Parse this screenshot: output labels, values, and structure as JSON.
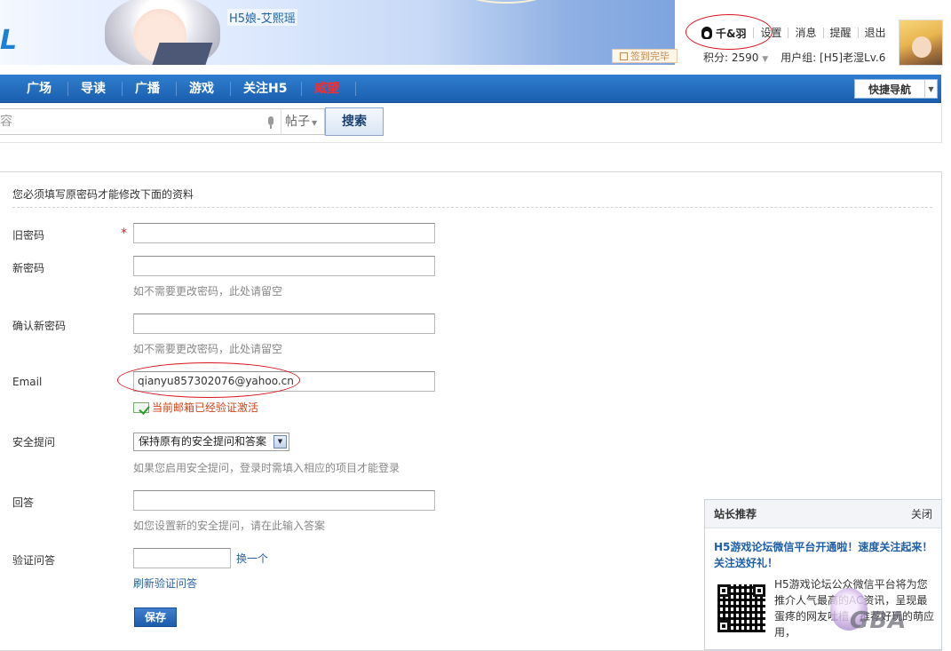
{
  "header": {
    "logo_text": "L",
    "site_subtitle": "H5娘-艾熙瑶",
    "user_name": "千&羽",
    "links": [
      "设置",
      "消息",
      "提醒",
      "退出"
    ],
    "checkin_label": "签到完毕",
    "points_label": "积分: 2590",
    "group_label": "用户组: [H5]老湿Lv.6"
  },
  "nav": {
    "items": [
      "广场",
      "导读",
      "广播",
      "游戏",
      "关注H5",
      "威望"
    ],
    "highlight_color": "#ff2a2a",
    "quick_nav_label": "快捷导航"
  },
  "search": {
    "placeholder_fragment": "容",
    "type_label": "帖子",
    "button_label": "搜索"
  },
  "form": {
    "notice": "您必须填写原密码才能修改下面的资料",
    "old_password_label": "旧密码",
    "required_mark": "*",
    "new_password_label": "新密码",
    "new_password_hint": "如不需要更改密码，此处请留空",
    "confirm_password_label": "确认新密码",
    "confirm_password_hint": "如不需要更改密码，此处请留空",
    "email_label": "Email",
    "email_value": "qianyu857302076@yahoo.cn",
    "email_status": "当前邮箱已经验证激活",
    "security_question_label": "安全提问",
    "security_question_value": "保持原有的安全提问和答案",
    "security_question_hint": "如果您启用安全提问，登录时需填入相应的项目才能登录",
    "answer_label": "回答",
    "answer_hint": "如您设置新的安全提问，请在此输入答案",
    "captcha_label": "验证问答",
    "captcha_change": "换一个",
    "captcha_refresh": "刷新验证问答",
    "save_label": "保存"
  },
  "recommend": {
    "title": "站长推荐",
    "close_label": "关闭",
    "headline": "H5游戏论坛微信平台开通啦！速度关注起来！关注送好礼！",
    "body": "H5游戏论坛公众微信平台将为您推介人气最高的AC资讯，呈现最蛋疼的网友吐槽，推荐好玩的萌应用，"
  },
  "watermark": {
    "text": "GBA"
  }
}
